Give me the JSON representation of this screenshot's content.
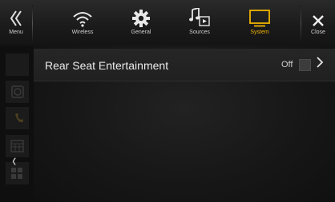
{
  "topbar": {
    "menu_label": "Menu",
    "items": [
      {
        "label": "Wireless",
        "icon": "wifi-icon"
      },
      {
        "label": "General",
        "icon": "gear-icon"
      },
      {
        "label": "Sources",
        "icon": "music-note-icon"
      },
      {
        "label": "System",
        "icon": "monitor-icon",
        "active": true
      }
    ],
    "close_label": "Close",
    "active_color": "#f0b400"
  },
  "main": {
    "row": {
      "title": "Rear Seat Entertainment",
      "value": "Off"
    }
  },
  "sidebar": {
    "icons": [
      "camera-icon",
      "bluetooth-phone-icon",
      "calendar-icon",
      "apps-grid-icon"
    ]
  }
}
